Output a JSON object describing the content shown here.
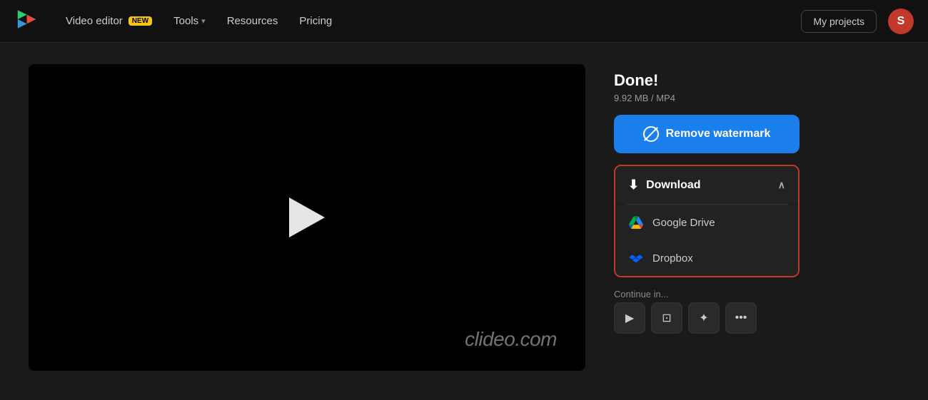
{
  "navbar": {
    "logo_label": "Clideo",
    "items": [
      {
        "id": "video-editor",
        "label": "Video editor",
        "badge": "NEW",
        "has_dropdown": false
      },
      {
        "id": "tools",
        "label": "Tools",
        "has_dropdown": true
      },
      {
        "id": "resources",
        "label": "Resources",
        "has_dropdown": false
      },
      {
        "id": "pricing",
        "label": "Pricing",
        "has_dropdown": false
      }
    ],
    "my_projects_label": "My projects",
    "avatar_letter": "S"
  },
  "video": {
    "watermark_text": "clideo.com"
  },
  "panel": {
    "done_title": "Done!",
    "file_size": "9.92 MB",
    "file_format": "MP4",
    "remove_watermark_label": "Remove watermark",
    "download_label": "Download",
    "google_drive_label": "Google Drive",
    "dropbox_label": "Dropbox",
    "continue_label": "Continue in..."
  },
  "icons": {
    "play": "▶",
    "download": "⬇",
    "chevron_up": "︿",
    "more": "•••",
    "video_edit": "▶",
    "subtitle": "⊡",
    "sparkle": "✦"
  }
}
